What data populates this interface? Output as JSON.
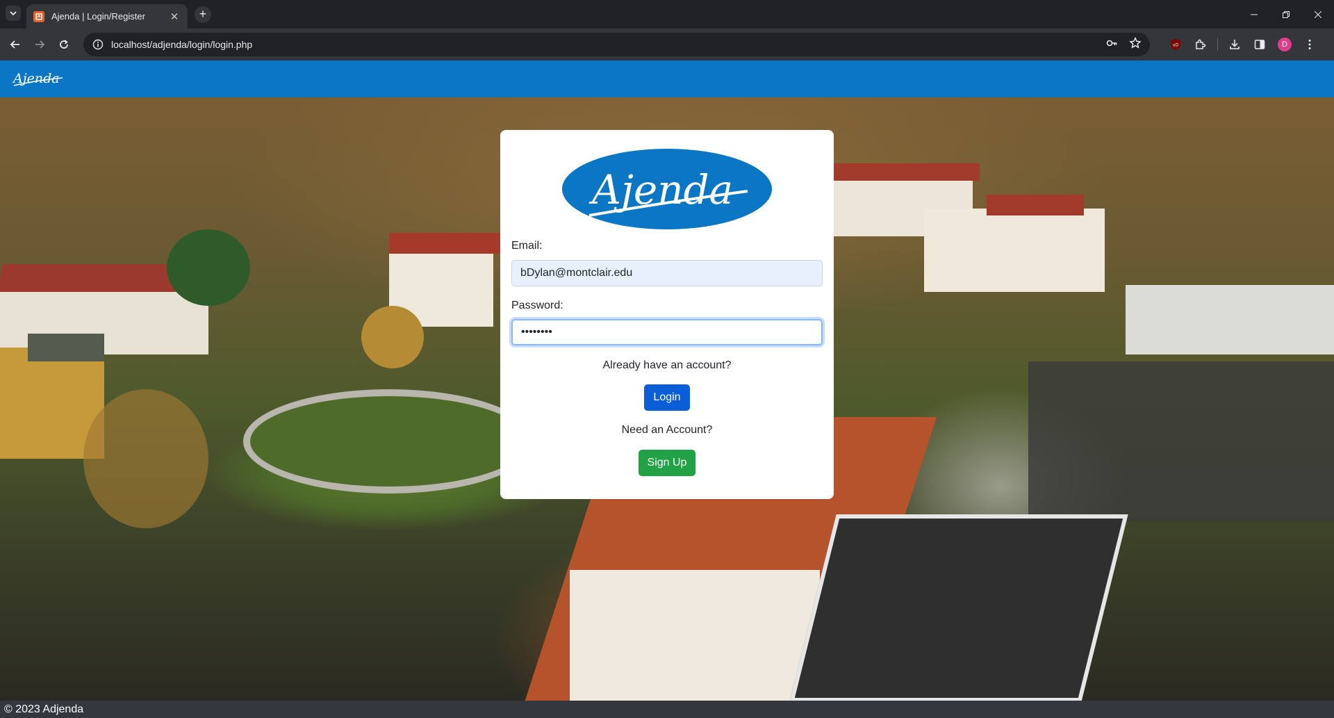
{
  "browser": {
    "tab_title": "Ajenda | Login/Register",
    "url": "localhost/adjenda/login/login.php",
    "profile_initial": "D",
    "ext_badge": "uD"
  },
  "navbar": {
    "brand": "Ajenda"
  },
  "login_card": {
    "logo_text": "Ajenda",
    "email_label": "Email:",
    "email_value": "bDylan@montclair.edu",
    "password_label": "Password:",
    "password_value": "••••••••",
    "already_text": "Already have an account?",
    "login_button": "Login",
    "need_text": "Need an Account?",
    "signup_button": "Sign Up"
  },
  "footer": {
    "text": "© 2023 Adjenda"
  },
  "colors": {
    "navbar": "#0b77c4",
    "login_button": "#0b5ed7",
    "signup_button": "#23a147",
    "logo_blue": "#0b77c4",
    "footer": "#32383e"
  }
}
